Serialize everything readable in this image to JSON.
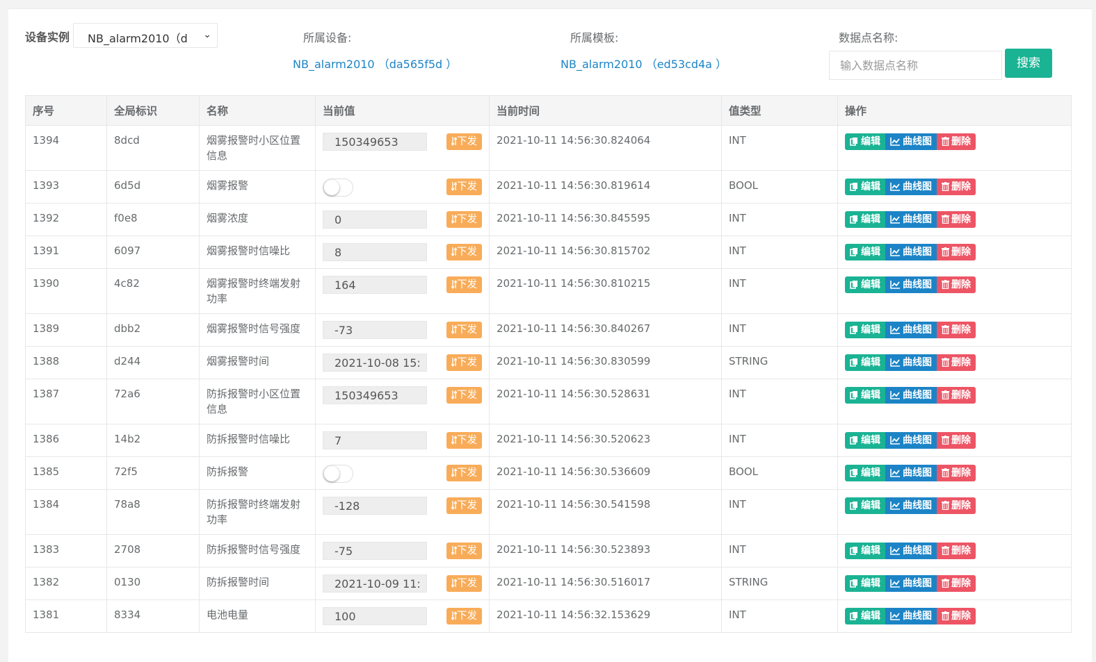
{
  "filters": {
    "device_instance_label": "设备实例",
    "device_instance_value": "NB_alarm2010（d",
    "owner_device_label": "所属设备:",
    "owner_device_link": "NB_alarm2010 （da565f5d ）",
    "owner_template_label": "所属模板:",
    "owner_template_link": "NB_alarm2010 （ed53cd4a ）",
    "datapoint_name_label": "数据点名称:",
    "datapoint_name_placeholder": "输入数据点名称",
    "search_button": "搜索"
  },
  "table": {
    "headers": [
      "序号",
      "全局标识",
      "名称",
      "当前值",
      "当前时间",
      "值类型",
      "操作"
    ],
    "send_label": "下发",
    "send_icon": "arrow-down-up-icon",
    "actions": {
      "edit": "编辑",
      "chart": "曲线图",
      "delete": "删除"
    },
    "rows": [
      {
        "id": "1394",
        "gid": "8dcd",
        "name": "烟雾报警时小区位置信息",
        "value": "150349653",
        "kind": "input",
        "time": "2021-10-11 14:56:30.824064",
        "type": "INT"
      },
      {
        "id": "1393",
        "gid": "6d5d",
        "name": "烟雾报警",
        "value": "",
        "kind": "toggle",
        "time": "2021-10-11 14:56:30.819614",
        "type": "BOOL"
      },
      {
        "id": "1392",
        "gid": "f0e8",
        "name": "烟雾浓度",
        "value": "0",
        "kind": "input",
        "time": "2021-10-11 14:56:30.845595",
        "type": "INT"
      },
      {
        "id": "1391",
        "gid": "6097",
        "name": "烟雾报警时信噪比",
        "value": "8",
        "kind": "input",
        "time": "2021-10-11 14:56:30.815702",
        "type": "INT"
      },
      {
        "id": "1390",
        "gid": "4c82",
        "name": "烟雾报警时终端发射功率",
        "value": "164",
        "kind": "input",
        "time": "2021-10-11 14:56:30.810215",
        "type": "INT"
      },
      {
        "id": "1389",
        "gid": "dbb2",
        "name": "烟雾报警时信号强度",
        "value": "-73",
        "kind": "input",
        "time": "2021-10-11 14:56:30.840267",
        "type": "INT"
      },
      {
        "id": "1388",
        "gid": "d244",
        "name": "烟雾报警时间",
        "value": "2021-10-08 15:",
        "kind": "input",
        "time": "2021-10-11 14:56:30.830599",
        "type": "STRING"
      },
      {
        "id": "1387",
        "gid": "72a6",
        "name": "防拆报警时小区位置信息",
        "value": "150349653",
        "kind": "input",
        "time": "2021-10-11 14:56:30.528631",
        "type": "INT"
      },
      {
        "id": "1386",
        "gid": "14b2",
        "name": "防拆报警时信噪比",
        "value": "7",
        "kind": "input",
        "time": "2021-10-11 14:56:30.520623",
        "type": "INT"
      },
      {
        "id": "1385",
        "gid": "72f5",
        "name": "防拆报警",
        "value": "",
        "kind": "toggle",
        "time": "2021-10-11 14:56:30.536609",
        "type": "BOOL"
      },
      {
        "id": "1384",
        "gid": "78a8",
        "name": "防拆报警时终端发射功率",
        "value": "-128",
        "kind": "input",
        "time": "2021-10-11 14:56:30.541598",
        "type": "INT"
      },
      {
        "id": "1383",
        "gid": "2708",
        "name": "防拆报警时信号强度",
        "value": "-75",
        "kind": "input",
        "time": "2021-10-11 14:56:30.523893",
        "type": "INT"
      },
      {
        "id": "1382",
        "gid": "0130",
        "name": "防拆报警时间",
        "value": "2021-10-09 11:",
        "kind": "input",
        "time": "2021-10-11 14:56:30.516017",
        "type": "STRING"
      },
      {
        "id": "1381",
        "gid": "8334",
        "name": "电池电量",
        "value": "100",
        "kind": "input",
        "time": "2021-10-11 14:56:32.153629",
        "type": "INT"
      }
    ]
  },
  "colors": {
    "primary_green": "#1ab394",
    "link_blue": "#1c84c6",
    "warning_orange": "#f8ac59",
    "danger_red": "#ed5565"
  }
}
